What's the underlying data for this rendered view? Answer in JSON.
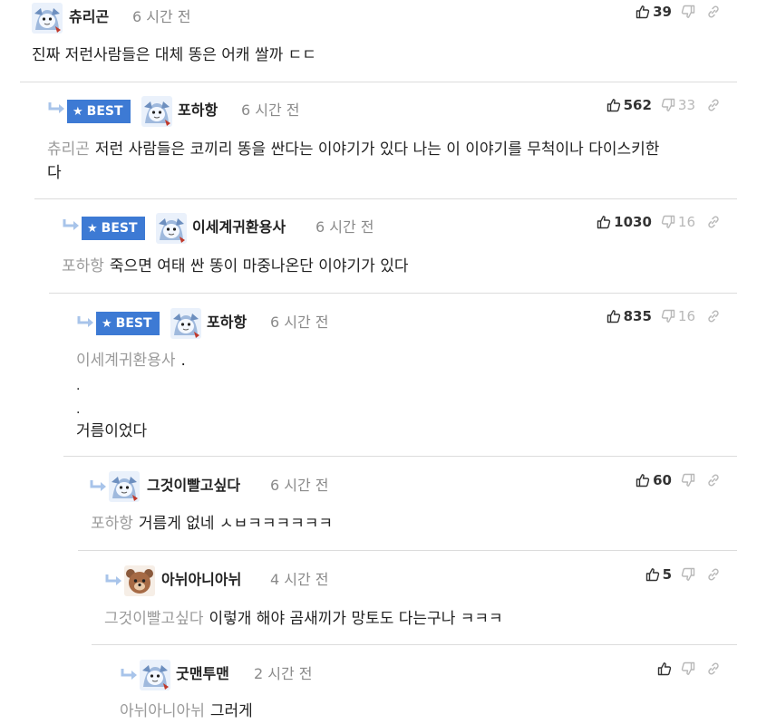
{
  "comments": [
    {
      "name": "츄리곤",
      "time": "6 시간 전",
      "upvotes": "39",
      "downvotes": "",
      "mention": "",
      "body": [
        "진짜 저런사람들은 대체 똥은 어캐 쌀까 ㄷㄷ"
      ],
      "best": ""
    },
    {
      "name": "포하항",
      "time": "6 시간 전",
      "upvotes": "562",
      "downvotes": "33",
      "mention": "츄리곤",
      "body": [
        "저런 사람들은 코끼리 똥을 싼다는 이야기가 있다 나는 이 이야기를 무척이나 다이스키한",
        "다"
      ],
      "best": "BEST"
    },
    {
      "name": "이세계귀환용사",
      "time": "6 시간 전",
      "upvotes": "1030",
      "downvotes": "16",
      "mention": "포하항",
      "body": [
        "죽으면 여태 싼 똥이 마중나온단 이야기가 있다"
      ],
      "best": "BEST"
    },
    {
      "name": "포하항",
      "time": "6 시간 전",
      "upvotes": "835",
      "downvotes": "16",
      "mention": "이세계귀환용사",
      "body": [
        ".",
        ".",
        ".",
        "거름이었다"
      ],
      "best": "BEST"
    },
    {
      "name": "그것이빨고싶다",
      "time": "6 시간 전",
      "upvotes": "60",
      "downvotes": "",
      "mention": "포하항",
      "body": [
        "거름게 없네 ㅅㅂㅋㅋㅋㅋㅋㅋ"
      ],
      "best": ""
    },
    {
      "name": "아뉘아니아뉘",
      "time": "4 시간 전",
      "upvotes": "5",
      "downvotes": "",
      "mention": "그것이빨고싶다",
      "body": [
        "이렇개 해야 곰새끼가 망토도 다는구나 ㅋㅋㅋ"
      ],
      "best": ""
    },
    {
      "name": "굿맨투맨",
      "time": "2 시간 전",
      "upvotes": "",
      "downvotes": "",
      "mention": "아뉘아니아뉘",
      "body": [
        "그러게"
      ],
      "best": ""
    }
  ],
  "colors": {
    "best_badge": "#3d7ad4",
    "mention": "#9a9a9a",
    "time": "#8a8a8a",
    "divider": "#dcdcdc"
  },
  "icons": {
    "upvote": "thumbs-up-icon",
    "downvote": "thumbs-down-icon",
    "link": "link-icon",
    "reply": "reply-arrow-icon",
    "best": "star-icon"
  }
}
